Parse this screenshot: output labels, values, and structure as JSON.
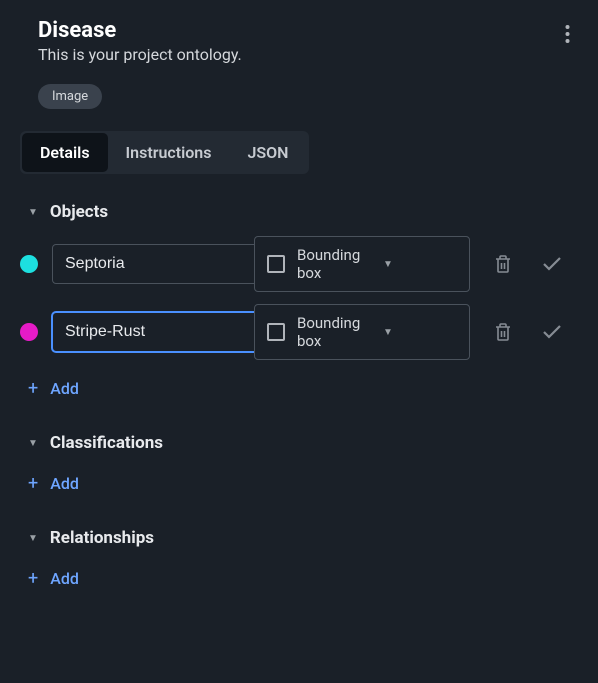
{
  "header": {
    "title": "Disease",
    "subtitle": "This is your project ontology."
  },
  "badge": "Image",
  "tabs": {
    "details": "Details",
    "instructions": "Instructions",
    "json": "JSON"
  },
  "sections": {
    "objects": {
      "title": "Objects",
      "rows": [
        {
          "name": "Septoria",
          "color": "#1de0e0",
          "shape": "Bounding box"
        },
        {
          "name": "Stripe-Rust",
          "color": "#e61bc7",
          "shape": "Bounding box"
        }
      ],
      "add": "Add"
    },
    "classifications": {
      "title": "Classifications",
      "add": "Add"
    },
    "relationships": {
      "title": "Relationships",
      "add": "Add"
    }
  }
}
